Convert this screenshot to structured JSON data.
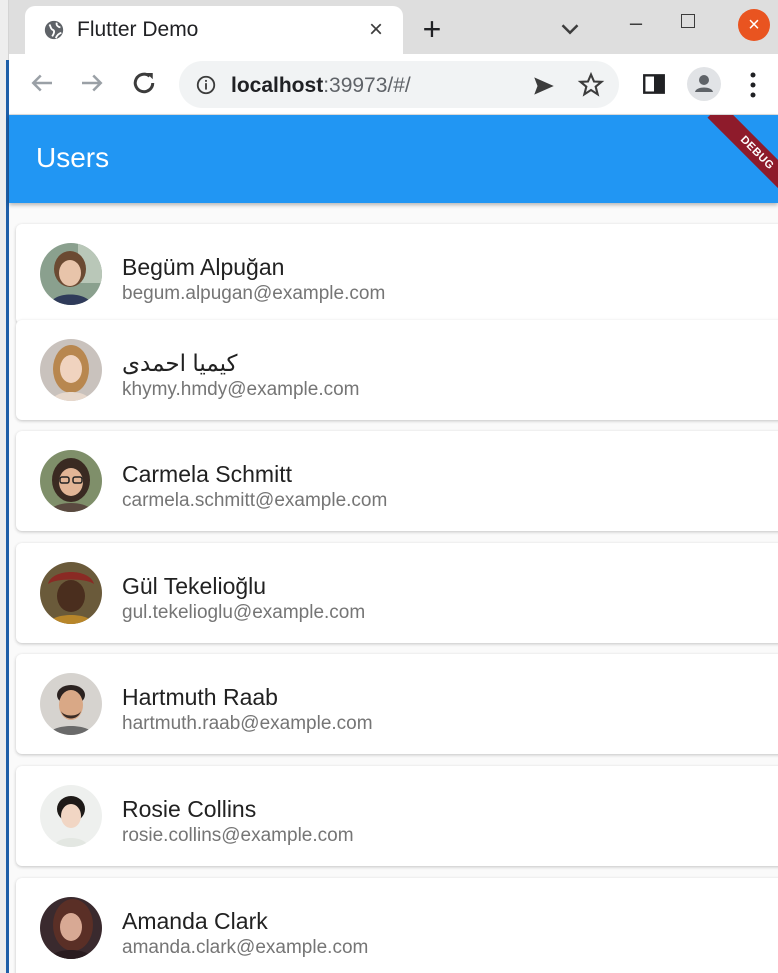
{
  "browser": {
    "tab": {
      "title": "Flutter Demo",
      "close_glyph": "×"
    },
    "new_tab_glyph": "+",
    "window_controls": {
      "minimize_glyph": "–",
      "close_glyph": "×"
    },
    "address": {
      "host": "localhost",
      "rest": ":39973/#/"
    },
    "icons": [
      "globe-icon",
      "close-icon",
      "plus-icon",
      "chevron-down-icon",
      "back-arrow-icon",
      "forward-arrow-icon",
      "reload-icon",
      "info-icon",
      "send-icon",
      "star-icon",
      "side-panel-icon",
      "profile-icon",
      "more-vert-icon"
    ]
  },
  "app": {
    "title": "Users",
    "debug_banner": "DEBUG",
    "colors": {
      "app_bar": "#2196f3",
      "debug": "#8e1b2b",
      "window_close": "#e95420"
    }
  },
  "users": [
    {
      "name": "Begüm Alpuğan",
      "email": "begum.alpugan@example.com"
    },
    {
      "name": "کیمیا احمدی",
      "email": "khymy.hmdy@example.com"
    },
    {
      "name": "Carmela Schmitt",
      "email": "carmela.schmitt@example.com"
    },
    {
      "name": "Gül Tekelioğlu",
      "email": "gul.tekelioglu@example.com"
    },
    {
      "name": "Hartmuth Raab",
      "email": "hartmuth.raab@example.com"
    },
    {
      "name": "Rosie Collins",
      "email": "rosie.collins@example.com"
    },
    {
      "name": "Amanda Clark",
      "email": "amanda.clark@example.com"
    }
  ]
}
